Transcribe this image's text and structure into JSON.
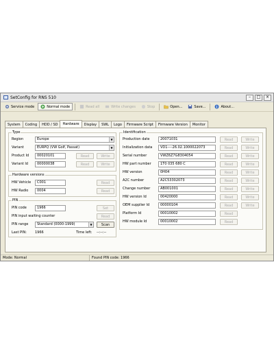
{
  "window": {
    "title": "SetConfig for RNS 510"
  },
  "toolbar": [
    {
      "label": "Service mode"
    },
    {
      "label": "Normal mode"
    },
    {
      "label": "Read all"
    },
    {
      "label": "Write changes"
    },
    {
      "label": "Stop"
    },
    {
      "label": "Open..."
    },
    {
      "label": "Save..."
    },
    {
      "label": "About..."
    }
  ],
  "tabs": [
    "System",
    "Coding",
    "HDD / SD",
    "Hardware",
    "Display",
    "SWL",
    "Logo",
    "Firmware Script",
    "Firmware Version",
    "Monitor"
  ],
  "type_group": {
    "title": "Type",
    "region_label": "Region",
    "region_value": "Europe",
    "variant_label": "Variant",
    "variant_value": "EURPQ (VW Golf, Passat)",
    "product_label": "Product Id",
    "product_value": "00020101",
    "variant_id_label": "Variant Id",
    "variant_id_value": "00000038",
    "read": "Read",
    "write": "Write"
  },
  "hw_versions": {
    "title": "Hardware versions",
    "vehicle_label": "HW Vehicle",
    "vehicle_value": "C001",
    "radio_label": "HW Radio",
    "radio_value": "0004",
    "read": "Read"
  },
  "pin": {
    "title": "PIN",
    "code_label": "PIN code",
    "code_value": "1966",
    "set": "Set",
    "waiting_label": "PIN input waiting counter",
    "read": "Read",
    "range_label": "PIN range",
    "range_value": "Standard (0000-1999)",
    "scan": "Scan",
    "last_label": "Last PIN:",
    "last_value": "1966",
    "time_label": "Time left:",
    "time_value": "--:--:--"
  },
  "identification": {
    "title": "Identification",
    "read": "Read",
    "write": "Write",
    "rows": [
      {
        "label": "Production date",
        "value": "20071031",
        "write": true
      },
      {
        "label": "Initialization data",
        "value": "VD1----26.02.1000022073",
        "write": true
      },
      {
        "label": "Serial number",
        "value": "VWZ6Z7G8304054",
        "write": true
      },
      {
        "label": "HW part number",
        "value": "1T0 035 680 C",
        "write": true
      },
      {
        "label": "HW version",
        "value": "0H04",
        "write": true
      },
      {
        "label": "A2C number",
        "value": "A2C53302073",
        "write": true
      },
      {
        "label": "Change number",
        "value": "AB001001",
        "write": true
      },
      {
        "label": "HW version Id",
        "value": "00420000",
        "write": true
      },
      {
        "label": "OEM supplier Id",
        "value": "00000104",
        "write": true
      },
      {
        "label": "Platform Id",
        "value": "00010002",
        "write": false
      },
      {
        "label": "HW module Id",
        "value": "00010002",
        "write": false
      }
    ]
  },
  "status": {
    "mode": "Mode: Normal",
    "message": "Found PIN code: 1966"
  }
}
